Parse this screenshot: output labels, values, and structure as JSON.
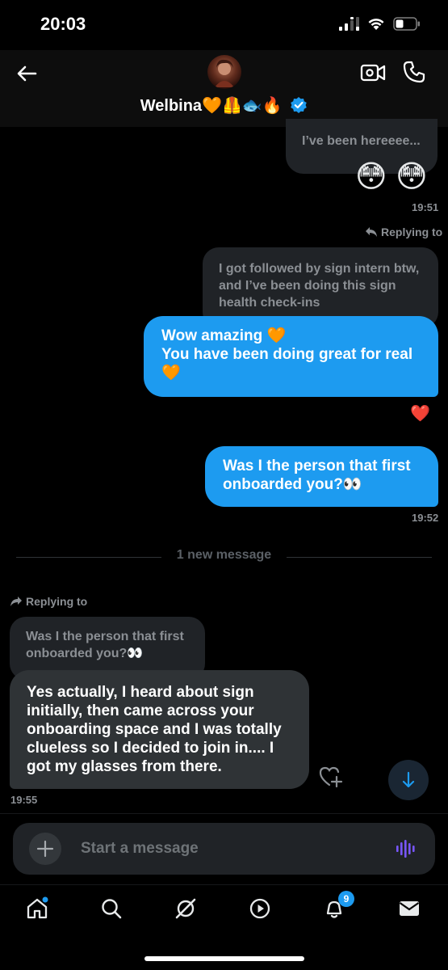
{
  "status_bar": {
    "time": "20:03"
  },
  "header": {
    "name": "Welbina🧡🦺🐟🔥",
    "verified": true
  },
  "messages": {
    "m1_partial": "I’ve been hereeee...",
    "m1_emoji": "😳 😳",
    "m1_time": "19:51",
    "reply_label_1": "Replying to",
    "quoted_1": "I got followed by sign intern btw, and I’ve been doing this sign health check-ins",
    "sent_1_line1": "Wow amazing 🧡",
    "sent_1_line2": "You have been doing great for real 🧡",
    "reaction_1": "❤️",
    "sent_2": "Was I the person that first onboarded you?👀",
    "sent_2_time": "19:52",
    "new_message_divider": "1 new message",
    "reply_label_2": "Replying to",
    "quoted_2": "Was I the person that first onboarded you?👀",
    "recv_1": "Yes actually, I heard about sign initially, then came across your onboarding space and I was totally clueless so I decided to join in.... I got my glasses from there.",
    "recv_1_time": "19:55"
  },
  "composer": {
    "placeholder": "Start a message"
  },
  "nav": {
    "notifications_badge": "9"
  },
  "colors": {
    "accent": "#1d9bf0",
    "background": "#000000",
    "received_bubble": "#2f3336",
    "quoted_bubble": "#202327",
    "voice_icon": "#7856ff"
  }
}
